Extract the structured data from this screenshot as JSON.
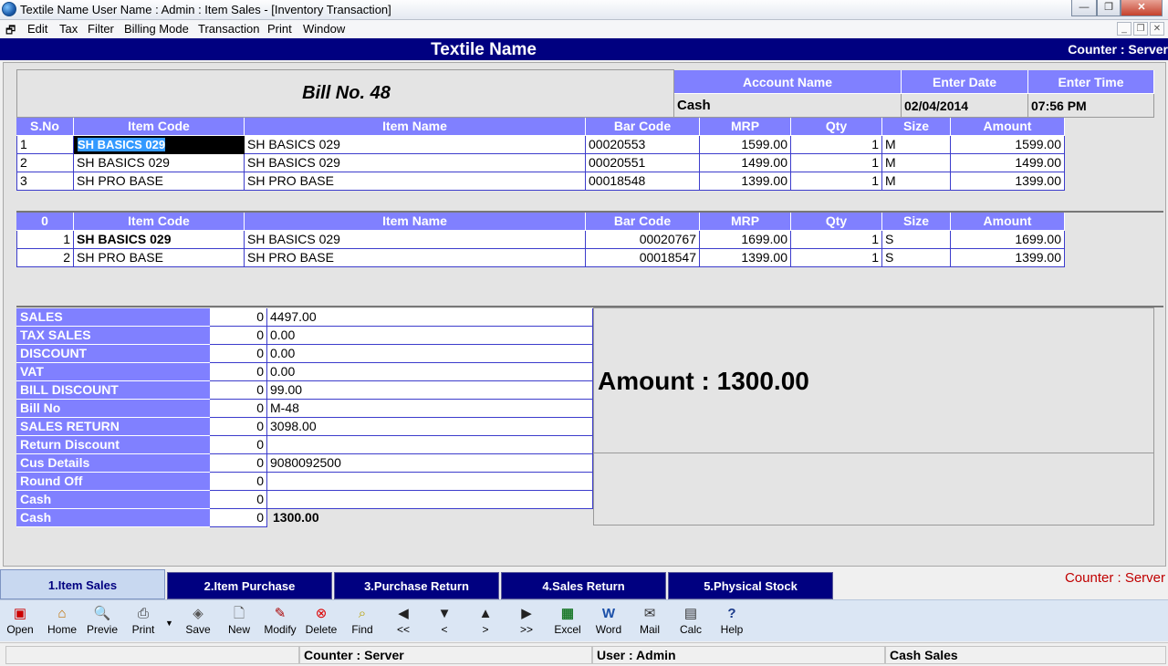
{
  "window": {
    "title": "Textile Name  User Name : Admin : Item Sales  - [Inventory Transaction]"
  },
  "menu": [
    "Edit",
    "Tax",
    "Filter",
    "Billing Mode",
    "Transaction",
    "Print",
    "Window"
  ],
  "header": {
    "title": "Textile Name",
    "counter": "Counter : Server"
  },
  "bill": {
    "label": "Bill No. 48",
    "account_header": "Account Name",
    "date_header": "Enter Date",
    "time_header": "Enter Time",
    "account": "Cash",
    "date": "02/04/2014",
    "time": "07:56 PM"
  },
  "sales_grid": {
    "headers": [
      "S.No",
      "Item Code",
      "Item Name",
      "Bar Code",
      "MRP",
      "Qty",
      "Size",
      "Amount"
    ],
    "rows": [
      [
        "1",
        "SH BASICS 029",
        "SH BASICS 029",
        "00020553",
        "1599.00",
        "1",
        "M",
        "1599.00"
      ],
      [
        "2",
        "SH BASICS 029",
        "SH BASICS 029",
        "00020551",
        "1499.00",
        "1",
        "M",
        "1499.00"
      ],
      [
        "3",
        "SH PRO BASE",
        "SH PRO BASE",
        "00018548",
        "1399.00",
        "1",
        "M",
        "1399.00"
      ]
    ]
  },
  "return_grid": {
    "headers": [
      "0",
      "Item Code",
      "Item Name",
      "Bar Code",
      "MRP",
      "Qty",
      "Size",
      "Amount"
    ],
    "rows": [
      [
        "1",
        "SH BASICS 029",
        "SH BASICS 029",
        "00020767",
        "1699.00",
        "1",
        "S",
        "1699.00"
      ],
      [
        "2",
        "SH PRO BASE",
        "SH PRO BASE",
        "00018547",
        "1399.00",
        "1",
        "S",
        "1399.00"
      ]
    ]
  },
  "summary": [
    {
      "label": "SALES",
      "zero": "0",
      "value": "4497.00"
    },
    {
      "label": "TAX SALES",
      "zero": "0",
      "value": "0.00"
    },
    {
      "label": "DISCOUNT",
      "zero": "0",
      "value": "0.00"
    },
    {
      "label": "VAT",
      "zero": "0",
      "value": "0.00"
    },
    {
      "label": "BILL DISCOUNT",
      "zero": "0",
      "value": "99.00"
    },
    {
      "label": "Bill No",
      "zero": "0",
      "value": "M-48"
    },
    {
      "label": "SALES RETURN",
      "zero": "0",
      "value": "3098.00"
    },
    {
      "label": "Return Discount",
      "zero": "0",
      "value": ""
    },
    {
      "label": "Cus Details",
      "zero": "0",
      "value": "9080092500"
    },
    {
      "label": "Round Off",
      "zero": "0",
      "value": ""
    },
    {
      "label": "Cash",
      "zero": "0",
      "value": ""
    },
    {
      "label": "Cash",
      "zero": "0",
      "value": "1300.00"
    }
  ],
  "amount_display": "Amount : 1300.00",
  "tabs": [
    "1.Item Sales",
    "2.Item Purchase",
    "3.Purchase Return",
    "4.Sales Return",
    "5.Physical Stock"
  ],
  "tab_counter": "Counter : Server",
  "toolbar": [
    {
      "label": "Open",
      "icon": "open-icon"
    },
    {
      "label": "Home",
      "icon": "home-icon"
    },
    {
      "label": "Previe",
      "icon": "preview-icon"
    },
    {
      "label": "Print",
      "icon": "printer-icon"
    },
    {
      "label": "Save",
      "icon": "save-icon"
    },
    {
      "label": "New",
      "icon": "new-icon"
    },
    {
      "label": "Modify",
      "icon": "modify-icon"
    },
    {
      "label": "Delete",
      "icon": "delete-icon"
    },
    {
      "label": "Find",
      "icon": "find-icon"
    },
    {
      "label": "<<",
      "icon": "first-icon"
    },
    {
      "label": "<",
      "icon": "previous-icon"
    },
    {
      "label": ">",
      "icon": "next-icon"
    },
    {
      "label": ">>",
      "icon": "last-icon"
    },
    {
      "label": "Excel",
      "icon": "excel-icon"
    },
    {
      "label": "Word",
      "icon": "word-icon"
    },
    {
      "label": "Mail",
      "icon": "mail-icon"
    },
    {
      "label": "Calc",
      "icon": "calculator-icon"
    },
    {
      "label": "Help",
      "icon": "help-icon"
    }
  ],
  "status": {
    "counter": "Counter : Server",
    "user": "User : Admin",
    "mode": "Cash Sales"
  },
  "colors": {
    "header_bg": "#000080",
    "grid_header": "#8080ff",
    "tab_bg": "#000080",
    "counter_red": "#c00000"
  }
}
